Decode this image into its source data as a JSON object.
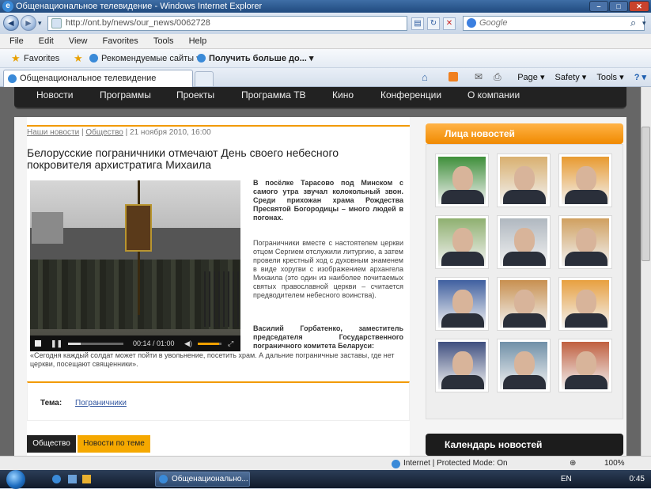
{
  "window": {
    "title": "Общенациональное телевидение - Windows Internet Explorer",
    "minimize": "–",
    "maximize": "□",
    "close": "✕"
  },
  "address": {
    "url": "http://ont.by/news/our_news/0062728",
    "search_placeholder": "Google"
  },
  "menu": [
    "File",
    "Edit",
    "View",
    "Favorites",
    "Tools",
    "Help"
  ],
  "favorites_bar": {
    "favorites": "Favorites",
    "suggested": "Рекомендуемые сайты ▾",
    "more": "Получить больше до... ▾"
  },
  "tab": {
    "title": "Общенациональное телевидение"
  },
  "command_bar": {
    "page": "Page ▾",
    "safety": "Safety ▾",
    "tools": "Tools ▾",
    "help": "? ▾"
  },
  "site_nav": [
    "Новости",
    "Программы",
    "Проекты",
    "Программа ТВ",
    "Кино",
    "Конференции",
    "О компании"
  ],
  "breadcrumb": {
    "section": "Наши новости",
    "sep": " | ",
    "category": "Общество",
    "date": "21 ноября 2010, 16:00"
  },
  "article": {
    "headline": "Белорусские пограничники отмечают День своего небесного покровителя архистратига Михаила",
    "lead": "В посёлке Тарасово под Минском с самого утра звучал колокольный звон. Среди прихожан храма Рождества Пресвятой Богородицы – много людей в погонах.",
    "body": "Пограничники вместе с настоятелем церкви отцом Сергием отслужили литургию, а затем провели крестный ход с духовным знаменем в виде хоругви с изображением архангела Михаила (это один из наиболее почитаемых святых православной церкви – считается предводителем небесного воинства).",
    "quote_author": "Василий Горбатенко, заместитель председателя Государственного пограничного комитета Беларуси:",
    "quote": "«Сегодня каждый солдат может пойти в увольнение, посетить храм. А дальние пограничные заставы, где нет церкви, посещают священники»."
  },
  "video": {
    "time": "00:14 / 01:00",
    "progress": 0.23,
    "volume": 0.9
  },
  "topic": {
    "label": "Тема:",
    "value": "Пограничники"
  },
  "bottom_tabs": {
    "society": "Общество",
    "related": "Новости по теме"
  },
  "sidebar": {
    "faces_title": "Лица новостей",
    "calendar_title": "Календарь новостей",
    "faces_colors": [
      "#3f8f3a",
      "#d9b070",
      "#e89a30",
      "#8fb070",
      "#b0b8c0",
      "#d0a060",
      "#4060a0",
      "#c89050",
      "#e8a040",
      "#405080",
      "#7090a8",
      "#c06040"
    ]
  },
  "status": {
    "zone": "Internet | Protected Mode: On",
    "zoom": "100%"
  },
  "taskbar": {
    "item": "Общенационально...",
    "lang": "EN",
    "time": "0:45"
  }
}
